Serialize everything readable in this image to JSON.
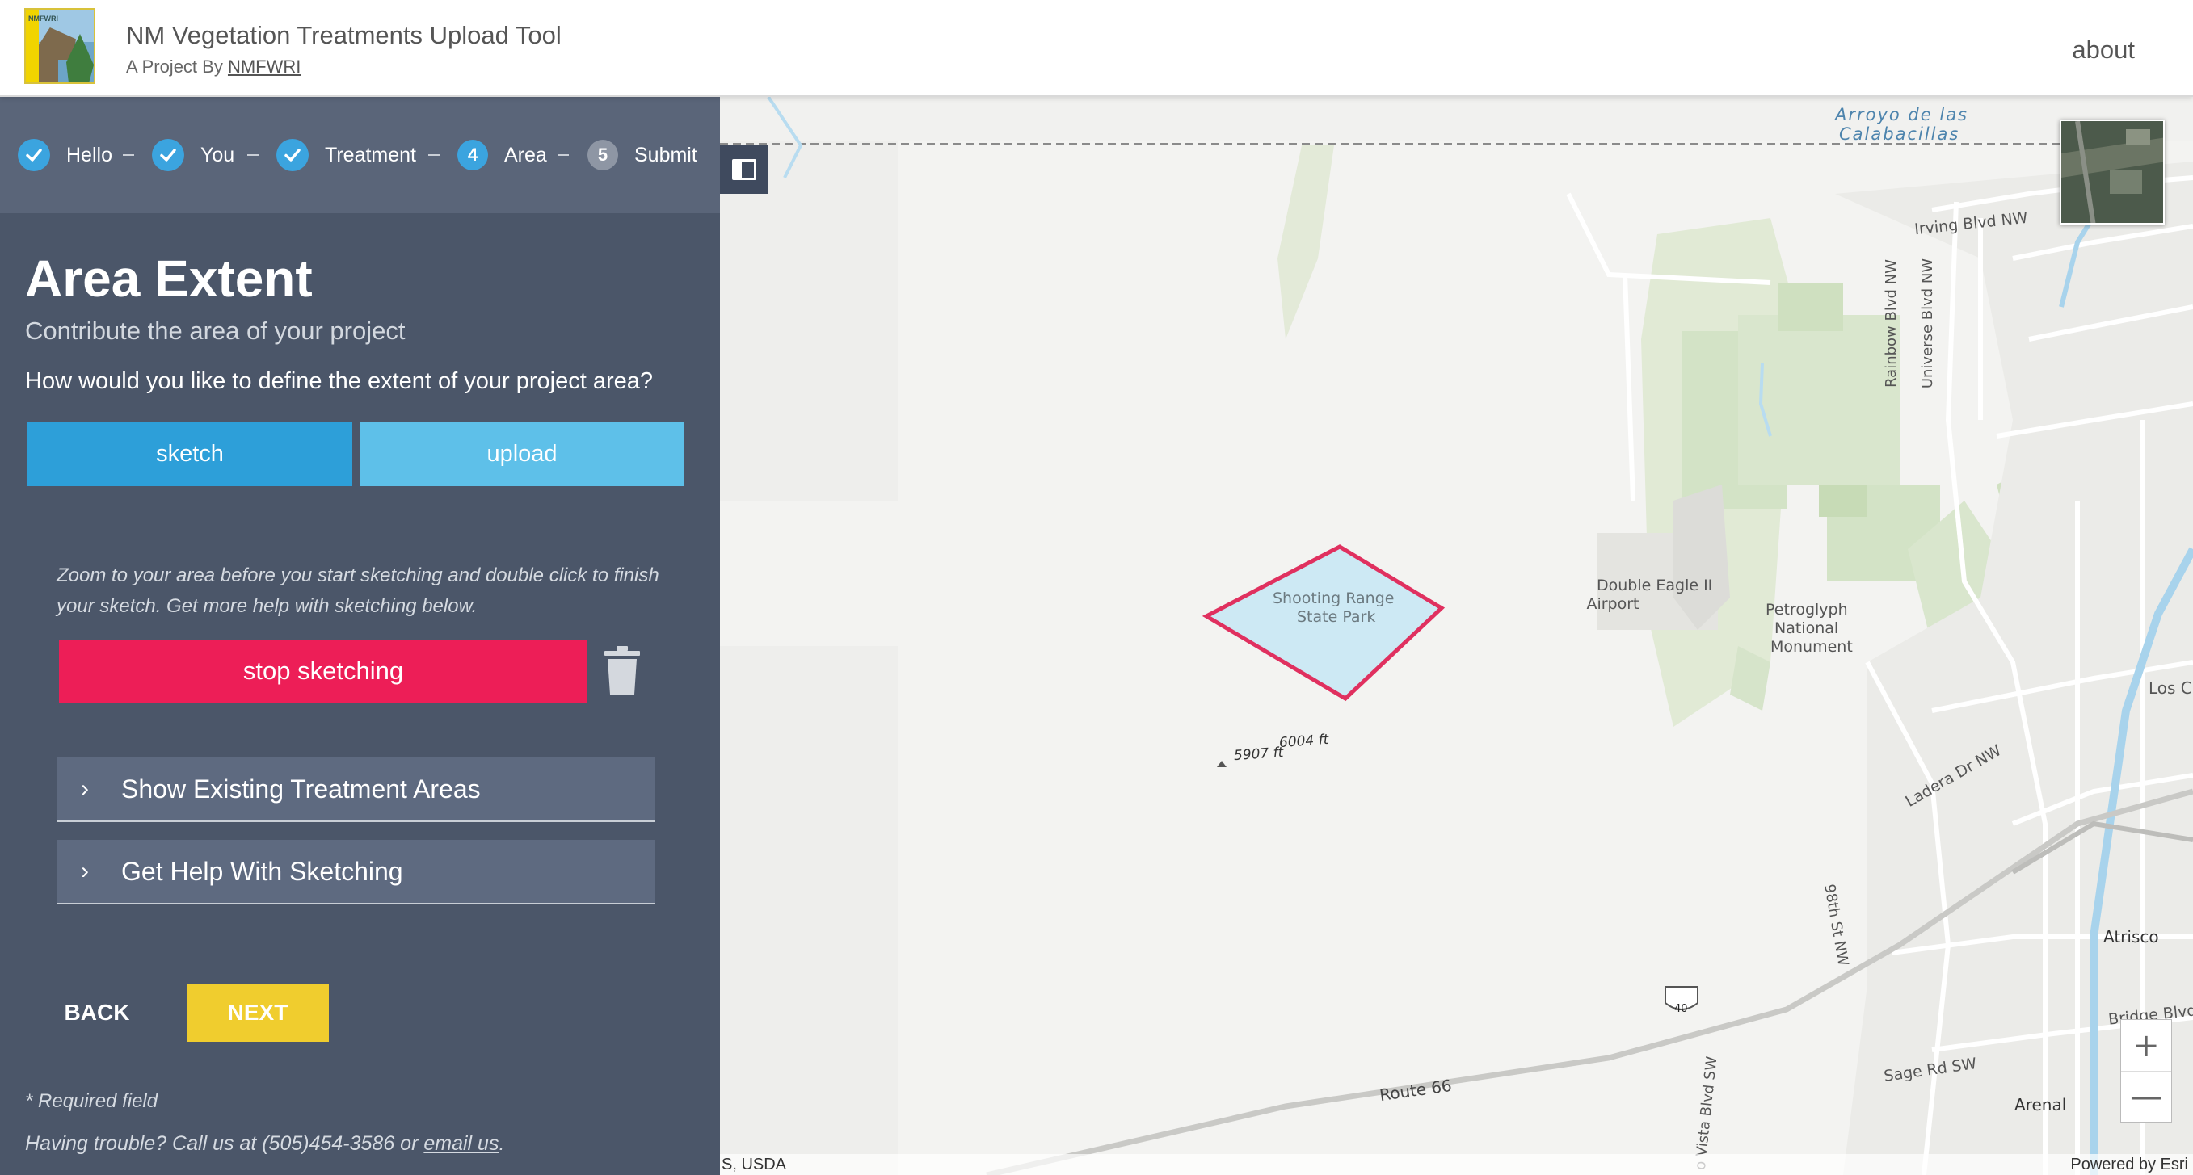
{
  "header": {
    "logo_alt": "NMFWRI",
    "logo_strip_text": "NMFWRI",
    "title": "NM Vegetation Treatments Upload Tool",
    "subtitle_prefix": "A Project By ",
    "subtitle_link": "NMFWRI",
    "about": "about"
  },
  "stepper": {
    "steps": [
      {
        "label": "Hello",
        "state": "done",
        "number": ""
      },
      {
        "label": "You",
        "state": "done",
        "number": ""
      },
      {
        "label": "Treatment",
        "state": "done",
        "number": ""
      },
      {
        "label": "Area",
        "state": "active",
        "number": "4"
      },
      {
        "label": "Submit",
        "state": "pending",
        "number": "5"
      }
    ]
  },
  "form": {
    "title": "Area Extent",
    "subtitle": "Contribute the area of your project",
    "question": "How would you like to define the extent of your project area?",
    "sketch_label": "sketch",
    "upload_label": "upload",
    "hint": "Zoom to your area before you start sketching and double click to finish your sketch. Get more help with sketching below.",
    "stop_label": "stop sketching",
    "accordions": [
      {
        "label": "Show Existing Treatment Areas"
      },
      {
        "label": "Get Help With Sketching"
      }
    ],
    "back_label": "BACK",
    "next_label": "NEXT",
    "required_note": "* Required field",
    "trouble_prefix": "Having trouble? Call us at (505)454-3586 or ",
    "trouble_link": "email us",
    "trouble_suffix": "."
  },
  "map": {
    "labels": {
      "arroyo_1": "Arroyo de las",
      "arroyo_2": "Calabacillas",
      "irving": "Irving Blvd NW",
      "rainbow": "Rainbow Blvd NW",
      "universe": "Universe Blvd NW",
      "shooting_1": "Shooting Range",
      "shooting_2": "State Park",
      "airport_1": "Double Eagle II",
      "airport_2": "Airport",
      "petro_1": "Petroglyph",
      "petro_2": "National",
      "petro_3": "Monument",
      "los": "Los C",
      "ladera": "Ladera Dr NW",
      "elev_1": "6004 ft",
      "elev_2": "5907 ft",
      "st98": "98th St NW",
      "interstate": "40",
      "atrisco": "Atrisco",
      "bridge": "Bridge Blvd",
      "route66": "Route 66",
      "sage": "Sage Rd SW",
      "arenal": "Arenal",
      "vista": "o Vista Blvd SW"
    },
    "attribution_left": "S, USDA",
    "attribution_right": "Powered by Esri",
    "zoom_in": "+",
    "zoom_out": "—",
    "sketch_fill": "#cde9f4",
    "sketch_stroke": "#e0305f"
  }
}
